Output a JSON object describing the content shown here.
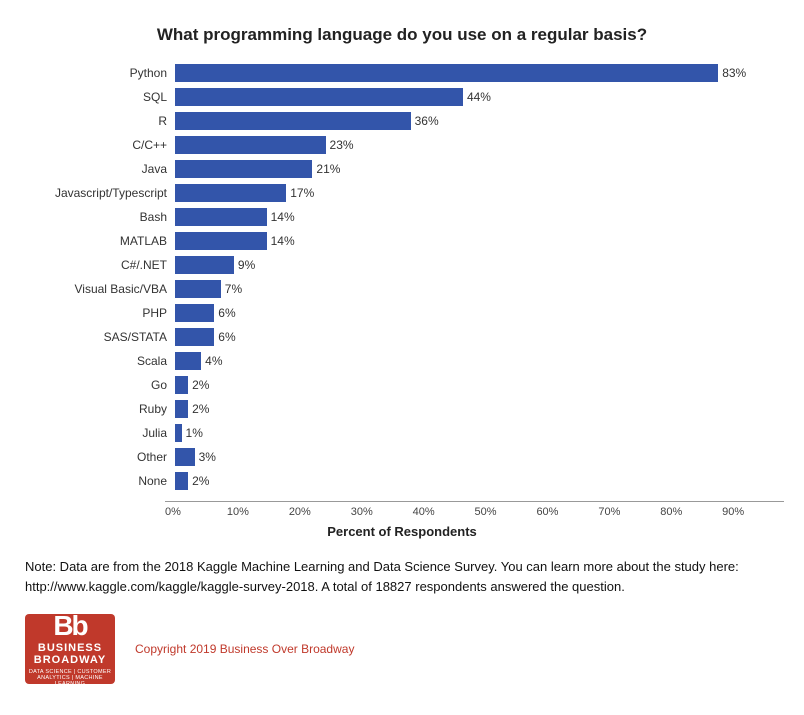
{
  "title": "What programming language do you use on a regular basis?",
  "bars": [
    {
      "label": "Python",
      "value": 83,
      "display": "83%"
    },
    {
      "label": "SQL",
      "value": 44,
      "display": "44%"
    },
    {
      "label": "R",
      "value": 36,
      "display": "36%"
    },
    {
      "label": "C/C++",
      "value": 23,
      "display": "23%"
    },
    {
      "label": "Java",
      "value": 21,
      "display": "21%"
    },
    {
      "label": "Javascript/Typescript",
      "value": 17,
      "display": "17%"
    },
    {
      "label": "Bash",
      "value": 14,
      "display": "14%"
    },
    {
      "label": "MATLAB",
      "value": 14,
      "display": "14%"
    },
    {
      "label": "C#/.NET",
      "value": 9,
      "display": "9%"
    },
    {
      "label": "Visual Basic/VBA",
      "value": 7,
      "display": "7%"
    },
    {
      "label": "PHP",
      "value": 6,
      "display": "6%"
    },
    {
      "label": "SAS/STATA",
      "value": 6,
      "display": "6%"
    },
    {
      "label": "Scala",
      "value": 4,
      "display": "4%"
    },
    {
      "label": "Go",
      "value": 2,
      "display": "2%"
    },
    {
      "label": "Ruby",
      "value": 2,
      "display": "2%"
    },
    {
      "label": "Julia",
      "value": 1,
      "display": "1%"
    },
    {
      "label": "Other",
      "value": 3,
      "display": "3%"
    },
    {
      "label": "None",
      "value": 2,
      "display": "2%"
    }
  ],
  "x_ticks": [
    "0%",
    "10%",
    "20%",
    "30%",
    "40%",
    "50%",
    "60%",
    "70%",
    "80%",
    "90%"
  ],
  "max_value": 90,
  "x_axis_label": "Percent of Respondents",
  "note": "Note: Data are from the 2018 Kaggle Machine Learning and Data Science Survey. You can learn more about the study here: http://www.kaggle.com/kaggle/kaggle-survey-2018.  A total of 18827 respondents answered the question.",
  "logo": {
    "initials": "Bb",
    "line1": "BUSINESS",
    "line2": "BROADWAY",
    "tagline": "DATA SCIENCE | CUSTOMER ANALYTICS | MACHINE LEARNING"
  },
  "copyright": "Copyright 2019 Business Over Broadway"
}
